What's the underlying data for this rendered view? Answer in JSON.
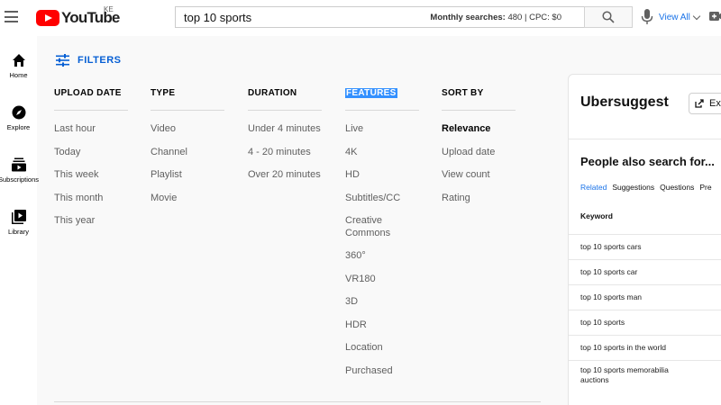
{
  "header": {
    "logo_text": "YouTube",
    "country_code": "KE",
    "search_query": "top 10 sports",
    "search_meta_prefix": "Monthly searches:",
    "search_meta_value": "480 | CPC: $0",
    "view_all_label": "View All"
  },
  "sidebar": {
    "items": [
      {
        "label": "Home",
        "icon": "home-icon"
      },
      {
        "label": "Explore",
        "icon": "compass-icon"
      },
      {
        "label": "Subscriptions",
        "icon": "subscriptions-icon"
      },
      {
        "label": "Library",
        "icon": "library-icon"
      }
    ]
  },
  "filters": {
    "label": "FILTERS",
    "columns": [
      {
        "heading": "UPLOAD DATE",
        "options": [
          "Last hour",
          "Today",
          "This week",
          "This month",
          "This year"
        ]
      },
      {
        "heading": "TYPE",
        "options": [
          "Video",
          "Channel",
          "Playlist",
          "Movie"
        ]
      },
      {
        "heading": "DURATION",
        "options": [
          "Under 4 minutes",
          "4 - 20 minutes",
          "Over 20 minutes"
        ]
      },
      {
        "heading": "FEATURES",
        "options": [
          "Live",
          "4K",
          "HD",
          "Subtitles/CC",
          "Creative Commons",
          "360°",
          "VR180",
          "3D",
          "HDR",
          "Location",
          "Purchased"
        ]
      },
      {
        "heading": "SORT BY",
        "options": [
          "Relevance",
          "Upload date",
          "View count",
          "Rating"
        ],
        "selected": "Relevance"
      }
    ],
    "highlighted_heading": "FEATURES"
  },
  "ubersuggest": {
    "title": "Ubersuggest",
    "export_label": "Ex",
    "section_title": "People also search for...",
    "tabs": [
      "Related",
      "Suggestions",
      "Questions",
      "Pre"
    ],
    "active_tab": "Related",
    "keyword_header": "Keyword",
    "keywords": [
      "top 10 sports cars",
      "top 10 sports car",
      "top 10 sports man",
      "top 10 sports",
      "top 10 sports in the world",
      "top 10 sports memorabilia auctions"
    ]
  },
  "colors": {
    "brand_red": "#ff0000",
    "link_blue": "#065fd4",
    "highlight": "#3390ff"
  }
}
